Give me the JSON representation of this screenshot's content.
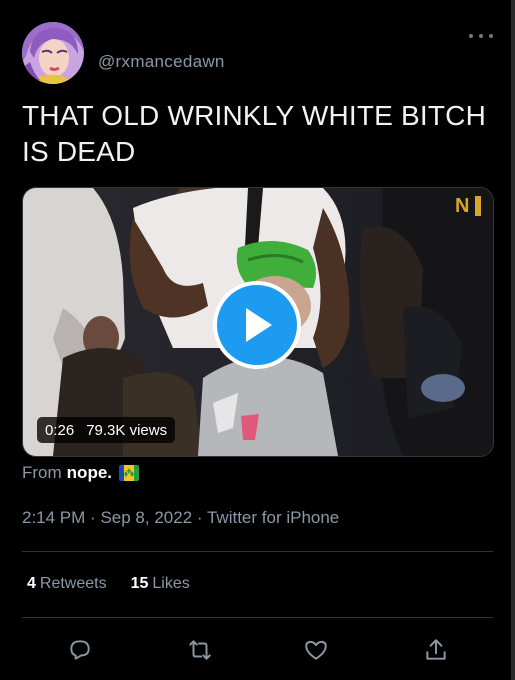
{
  "tweet": {
    "handle": "@rxmancedawn",
    "text": "THAT OLD WRINKLY WHITE BITCH IS DEAD",
    "video": {
      "duration": "0:26",
      "views": "79.3K views",
      "watermark": "N"
    },
    "source": {
      "prefix": "From",
      "name": "nope.",
      "flag_icon": "saint-vincent-flag-icon"
    },
    "meta": {
      "time": "2:14 PM",
      "separator": "·",
      "date": "Sep 8, 2022",
      "app": "Twitter for iPhone"
    },
    "stats": {
      "retweets_count": "4",
      "retweets_label": "Retweets",
      "likes_count": "15",
      "likes_label": "Likes"
    }
  },
  "icons": {
    "more": "more-dots-icon",
    "reply": "reply-icon",
    "retweet": "retweet-icon",
    "like": "heart-icon",
    "share": "share-icon",
    "play": "play-icon"
  },
  "colors": {
    "background": "#000000",
    "text": "#ffffff",
    "secondary_text": "#8b98a5",
    "accent_blue": "#1d9bf0",
    "divider": "#2f3336"
  }
}
